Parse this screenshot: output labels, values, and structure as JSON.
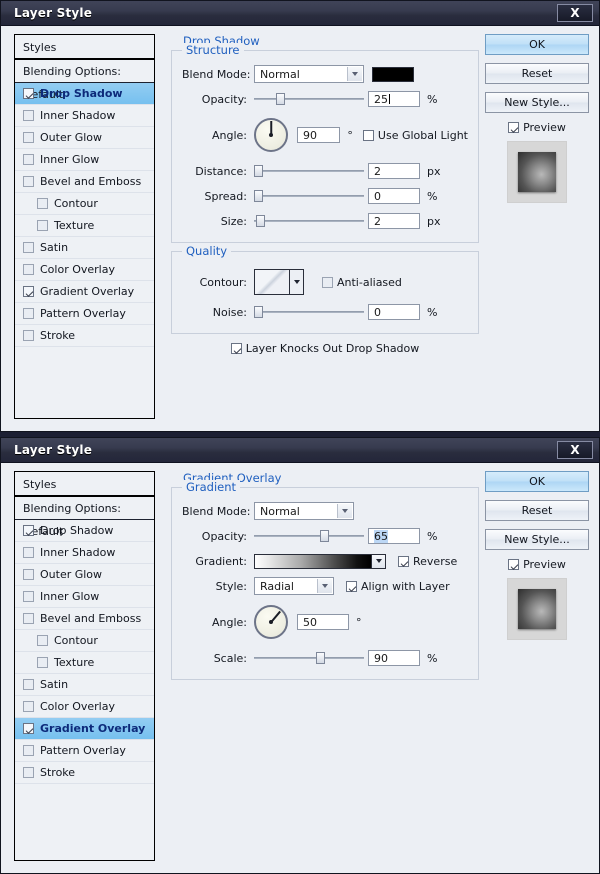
{
  "dialogs": [
    {
      "title": "Layer Style",
      "close_label": "X",
      "styles": {
        "header": "Styles",
        "blending_options": "Blending Options: Default",
        "items": [
          {
            "label": "Drop Shadow",
            "checked": true,
            "selected": true,
            "indent": false
          },
          {
            "label": "Inner Shadow",
            "checked": false,
            "selected": false,
            "indent": false
          },
          {
            "label": "Outer Glow",
            "checked": false,
            "selected": false,
            "indent": false
          },
          {
            "label": "Inner Glow",
            "checked": false,
            "selected": false,
            "indent": false
          },
          {
            "label": "Bevel and Emboss",
            "checked": false,
            "selected": false,
            "indent": false
          },
          {
            "label": "Contour",
            "checked": false,
            "selected": false,
            "indent": true
          },
          {
            "label": "Texture",
            "checked": false,
            "selected": false,
            "indent": true
          },
          {
            "label": "Satin",
            "checked": false,
            "selected": false,
            "indent": false
          },
          {
            "label": "Color Overlay",
            "checked": false,
            "selected": false,
            "indent": false
          },
          {
            "label": "Gradient Overlay",
            "checked": true,
            "selected": false,
            "indent": false
          },
          {
            "label": "Pattern Overlay",
            "checked": false,
            "selected": false,
            "indent": false
          },
          {
            "label": "Stroke",
            "checked": false,
            "selected": false,
            "indent": false
          }
        ]
      },
      "panel_title": "Drop Shadow",
      "structure": {
        "legend": "Structure",
        "blend_mode_label": "Blend Mode:",
        "blend_mode_value": "Normal",
        "shadow_color": "#000000",
        "opacity_label": "Opacity:",
        "opacity_value": "25",
        "opacity_unit": "%",
        "angle_label": "Angle:",
        "angle_value": "90",
        "angle_unit": "°",
        "use_global_light": "Use Global Light",
        "use_global_light_checked": false,
        "distance_label": "Distance:",
        "distance_value": "2",
        "distance_unit": "px",
        "spread_label": "Spread:",
        "spread_value": "0",
        "spread_unit": "%",
        "size_label": "Size:",
        "size_value": "2",
        "size_unit": "px"
      },
      "quality": {
        "legend": "Quality",
        "contour_label": "Contour:",
        "anti_aliased": "Anti-aliased",
        "anti_aliased_checked": false,
        "noise_label": "Noise:",
        "noise_value": "0",
        "noise_unit": "%"
      },
      "knockout": {
        "label": "Layer Knocks Out Drop Shadow",
        "checked": true
      },
      "buttons": {
        "ok": "OK",
        "reset": "Reset",
        "new_style": "New Style...",
        "preview": "Preview",
        "preview_checked": true
      }
    },
    {
      "title": "Layer Style",
      "close_label": "X",
      "styles": {
        "header": "Styles",
        "blending_options": "Blending Options: Default",
        "items": [
          {
            "label": "Drop Shadow",
            "checked": true,
            "selected": false,
            "indent": false
          },
          {
            "label": "Inner Shadow",
            "checked": false,
            "selected": false,
            "indent": false
          },
          {
            "label": "Outer Glow",
            "checked": false,
            "selected": false,
            "indent": false
          },
          {
            "label": "Inner Glow",
            "checked": false,
            "selected": false,
            "indent": false
          },
          {
            "label": "Bevel and Emboss",
            "checked": false,
            "selected": false,
            "indent": false
          },
          {
            "label": "Contour",
            "checked": false,
            "selected": false,
            "indent": true
          },
          {
            "label": "Texture",
            "checked": false,
            "selected": false,
            "indent": true
          },
          {
            "label": "Satin",
            "checked": false,
            "selected": false,
            "indent": false
          },
          {
            "label": "Color Overlay",
            "checked": false,
            "selected": false,
            "indent": false
          },
          {
            "label": "Gradient Overlay",
            "checked": true,
            "selected": true,
            "indent": false
          },
          {
            "label": "Pattern Overlay",
            "checked": false,
            "selected": false,
            "indent": false
          },
          {
            "label": "Stroke",
            "checked": false,
            "selected": false,
            "indent": false
          }
        ]
      },
      "panel_title": "Gradient Overlay",
      "gradient": {
        "legend": "Gradient",
        "blend_mode_label": "Blend Mode:",
        "blend_mode_value": "Normal",
        "opacity_label": "Opacity:",
        "opacity_value": "65",
        "opacity_unit": "%",
        "gradient_label": "Gradient:",
        "gradient_from": "#ffffff",
        "gradient_to": "#000000",
        "reverse": "Reverse",
        "reverse_checked": true,
        "style_label": "Style:",
        "style_value": "Radial",
        "align_with_layer": "Align with Layer",
        "align_with_layer_checked": true,
        "angle_label": "Angle:",
        "angle_value": "50",
        "angle_unit": "°",
        "scale_label": "Scale:",
        "scale_value": "90",
        "scale_unit": "%"
      },
      "buttons": {
        "ok": "OK",
        "reset": "Reset",
        "new_style": "New Style...",
        "preview": "Preview",
        "preview_checked": true
      }
    }
  ]
}
